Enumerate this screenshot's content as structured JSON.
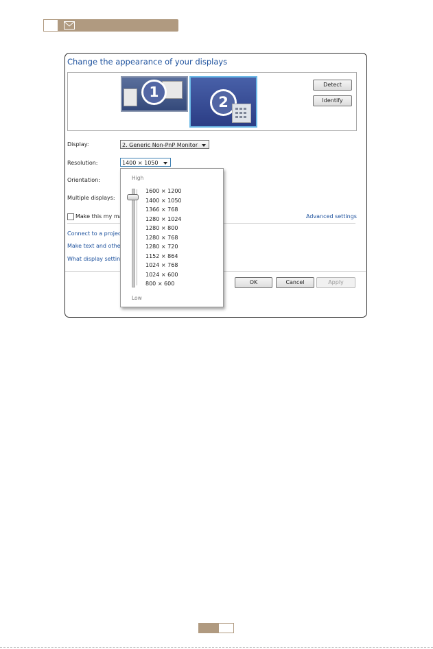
{
  "colors": {
    "accent_tan": "#b09a80",
    "link_blue": "#1a4f9c",
    "selected_monitor_border": "#6cb9e6"
  },
  "header_icon": "envelope-icon",
  "window": {
    "title": "Change the appearance of your displays",
    "monitors": [
      {
        "number": "1"
      },
      {
        "number": "2"
      }
    ],
    "buttons": {
      "detect": "Detect",
      "identify": "Identify",
      "ok": "OK",
      "cancel": "Cancel",
      "apply": "Apply"
    },
    "display": {
      "label": "Display:",
      "value": "2. Generic Non-PnP Monitor"
    },
    "resolution": {
      "label": "Resolution:",
      "value": "1400 × 1050"
    },
    "orientation": {
      "label": "Orientation:"
    },
    "multiple_displays": {
      "label": "Multiple displays:"
    },
    "make_main_checkbox": {
      "label": "Make this my ma",
      "checked": false
    },
    "advanced_settings": "Advanced settings",
    "links": [
      "Connect to a projec",
      "Make text and other",
      "What display setting"
    ],
    "resolution_dropdown": {
      "high_label": "High",
      "low_label": "Low",
      "selected_index": 1,
      "options": [
        "1600 × 1200",
        "1400 × 1050",
        "1366 × 768",
        "1280 × 1024",
        "1280 × 800",
        "1280 × 768",
        "1280 × 720",
        "1152 × 864",
        "1024 × 768",
        "1024 × 600",
        "800 × 600"
      ]
    }
  }
}
